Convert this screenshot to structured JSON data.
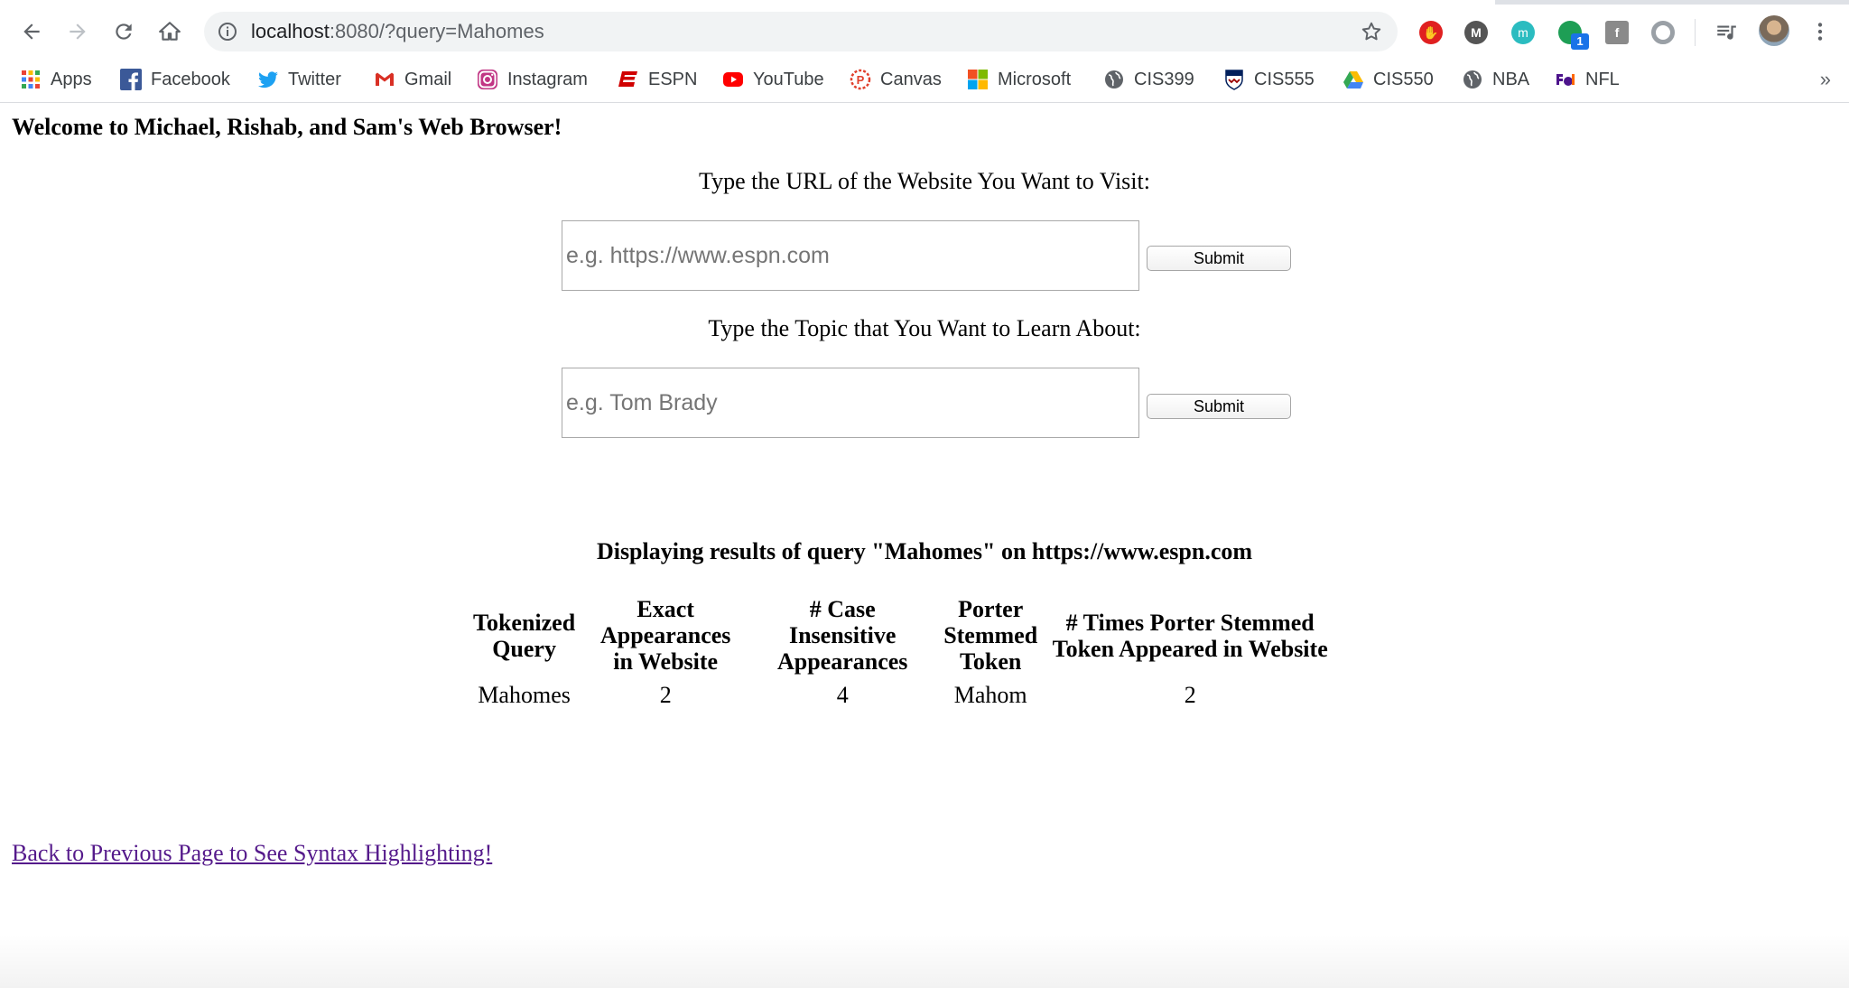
{
  "browser": {
    "url_host": "localhost",
    "url_rest": ":8080/?query=Mahomes",
    "extensions": [
      {
        "name": "adblock",
        "color": "#e02020",
        "glyph": "✋"
      },
      {
        "name": "m-dark",
        "color": "#555555",
        "glyph": "M"
      },
      {
        "name": "m-teal",
        "color": "#2bbcc0",
        "glyph": "m"
      },
      {
        "name": "green-dot",
        "color": "#1e9e55",
        "glyph": "",
        "badge": "1"
      },
      {
        "name": "facebook-square",
        "color": "#8a8a8a",
        "glyph": "f"
      },
      {
        "name": "circle-grey",
        "color": "#9aa0a6",
        "glyph": ""
      }
    ]
  },
  "bookmarks": [
    {
      "label": "Apps",
      "icon": "apps-grid-icon"
    },
    {
      "label": "Facebook",
      "icon": "facebook-icon",
      "color": "#3b5998"
    },
    {
      "label": "Twitter",
      "icon": "twitter-icon",
      "color": "#1da1f2"
    },
    {
      "label": "Gmail",
      "icon": "gmail-icon",
      "color": "#d93025"
    },
    {
      "label": "Instagram",
      "icon": "instagram-icon",
      "color": "#c13584"
    },
    {
      "label": "ESPN",
      "icon": "espn-icon",
      "color": "#d00000"
    },
    {
      "label": "YouTube",
      "icon": "youtube-icon",
      "color": "#ff0000"
    },
    {
      "label": "Canvas",
      "icon": "canvas-icon",
      "color": "#e13f2b"
    },
    {
      "label": "Microsoft",
      "icon": "microsoft-icon"
    },
    {
      "label": "CIS399",
      "icon": "globe-icon",
      "color": "#5f6368"
    },
    {
      "label": "CIS555",
      "icon": "penn-shield-icon",
      "color": "#011f5b"
    },
    {
      "label": "CIS550",
      "icon": "google-drive-icon"
    },
    {
      "label": "NBA",
      "icon": "globe-icon",
      "color": "#5f6368"
    },
    {
      "label": "NFL",
      "icon": "fedex-icon",
      "color": "#4d148c"
    }
  ],
  "bookmarks_overflow": "»",
  "page": {
    "welcome": "Welcome to Michael, Rishab, and Sam's Web Browser!",
    "url_prompt": "Type the URL of the Website You Want to Visit:",
    "url_placeholder": "e.g. https://www.espn.com",
    "topic_prompt": "Type the Topic that You Want to Learn About:",
    "topic_placeholder": "e.g. Tom Brady",
    "submit_label": "Submit",
    "results_title": "Displaying results of query \"Mahomes\" on https://www.espn.com",
    "table": {
      "headers": [
        "Tokenized Query",
        "Exact Appearances in Website",
        "# Case Insensitive Appearances",
        "Porter Stemmed Token",
        "# Times Porter Stemmed Token Appeared in Website"
      ],
      "rows": [
        [
          "Mahomes",
          "2",
          "4",
          "Mahom",
          "2"
        ]
      ]
    },
    "back_link": "Back to Previous Page to See Syntax Highlighting!"
  }
}
